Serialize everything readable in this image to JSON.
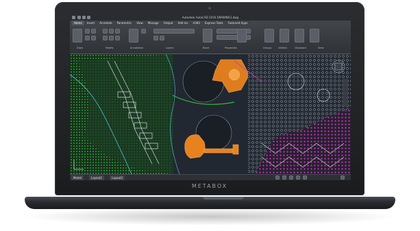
{
  "laptop": {
    "brand_logo": "METABOX"
  },
  "autocad": {
    "app_title": "Autodesk AutoCAD 2016  DRAWING1.dwg",
    "ribbon_tabs": [
      "Home",
      "Insert",
      "Annotate",
      "Parametric",
      "View",
      "Manage",
      "Output",
      "Add-ins",
      "A360",
      "Express Tools",
      "Featured Apps"
    ],
    "active_tab": "Home",
    "panels": [
      "Draw",
      "Modify",
      "Annotation",
      "Layers",
      "Block",
      "Properties",
      "Groups",
      "Utilities",
      "Clipboard",
      "View"
    ],
    "layout_tabs": [
      "Model",
      "Layout1",
      "Layout2"
    ],
    "colors": {
      "ribbon": "#3a3d42",
      "canvas": "#222831",
      "accent_orange": "#e8821e",
      "linework_green": "#2fbf3a",
      "linework_white": "#d9dde3",
      "linework_magenta": "#c23ac9",
      "linework_cyan": "#59c8e8"
    },
    "icons": [
      "arrow-icon",
      "layer-icon",
      "block-icon",
      "properties-icon",
      "viewcube-icon",
      "grid-icon"
    ]
  }
}
